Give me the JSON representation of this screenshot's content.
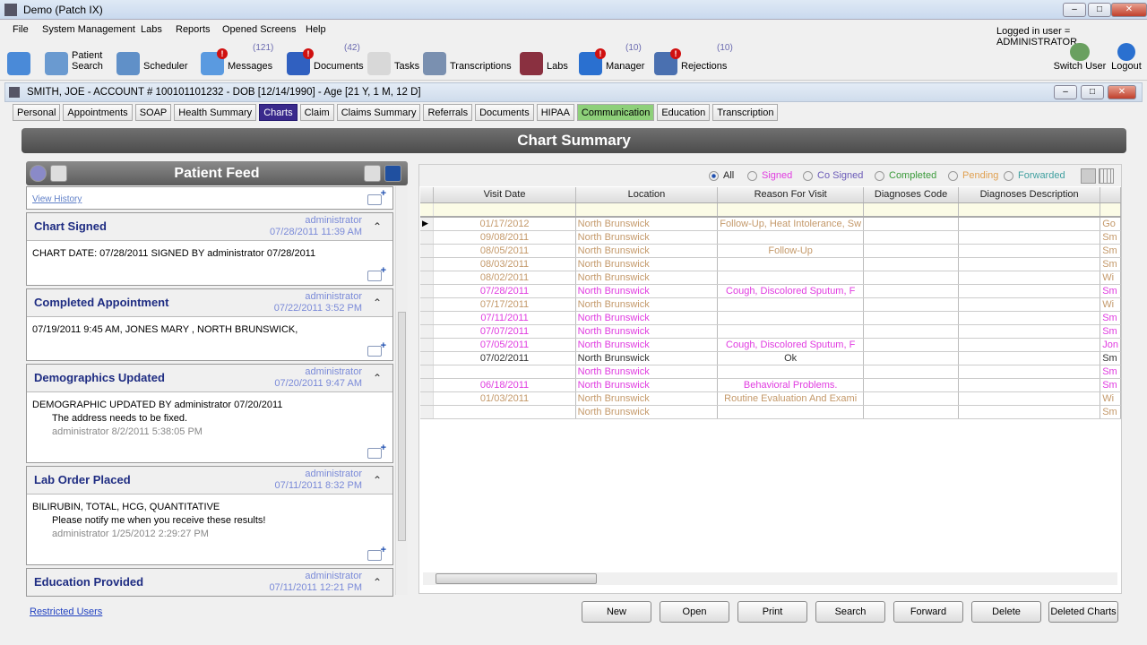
{
  "window": {
    "title": "Demo (Patch IX)"
  },
  "menu": [
    "File",
    "System Management",
    "Labs",
    "Reports",
    "Opened Screens",
    "Help"
  ],
  "logged_in": "Logged in user = ADMINISTRATOR",
  "toolbar": [
    {
      "label": "",
      "icon": "home-icon",
      "color": "#4a8ad8"
    },
    {
      "label": "Patient\nSearch",
      "icon": "patient-search-icon",
      "color": "#6a9ad0"
    },
    {
      "label": "Scheduler",
      "icon": "scheduler-icon",
      "color": "#6090c8"
    },
    {
      "label": "Messages",
      "icon": "messages-icon",
      "color": "#5a9ae0",
      "count": "(121)",
      "alert": true
    },
    {
      "label": "Documents",
      "icon": "documents-icon",
      "color": "#3060c0",
      "count": "(42)",
      "alert": true
    },
    {
      "label": "Tasks",
      "icon": "tasks-icon",
      "color": "#d8d8d8"
    },
    {
      "label": "Transcriptions",
      "icon": "transcriptions-icon",
      "color": "#7a90b0"
    },
    {
      "label": "Labs",
      "icon": "labs-icon",
      "color": "#8a3040"
    },
    {
      "label": "Manager",
      "icon": "rx-manager-icon",
      "color": "#2a70d0",
      "count": "(10)",
      "alert": true
    },
    {
      "label": "Rejections",
      "icon": "rejections-icon",
      "color": "#4a70b0",
      "count": "(10)",
      "alert": true
    }
  ],
  "switch_user": "Switch User",
  "logout": "Logout",
  "patient": {
    "header": "SMITH, JOE - ACCOUNT # 100101101232 - DOB [12/14/1990] - Age [21 Y, 1 M, 12 D]"
  },
  "tabs": [
    {
      "label": "Personal"
    },
    {
      "label": "Appointments"
    },
    {
      "label": "SOAP"
    },
    {
      "label": "Health Summary"
    },
    {
      "label": "Charts",
      "active": true
    },
    {
      "label": "Claim"
    },
    {
      "label": "Claims Summary"
    },
    {
      "label": "Referrals"
    },
    {
      "label": "Documents"
    },
    {
      "label": "HIPAA"
    },
    {
      "label": "Communication",
      "green": true
    },
    {
      "label": "Education"
    },
    {
      "label": "Transcription"
    }
  ],
  "summary_title": "Chart Summary",
  "feed": {
    "title": "Patient Feed",
    "view_history": "View History",
    "cards": [
      {
        "title": "Chart Signed",
        "user": "administrator",
        "time": "07/28/2011 11:39 AM",
        "text": "CHART DATE: 07/28/2011 SIGNED BY administrator 07/28/2011",
        "note": "",
        "meta": ""
      },
      {
        "title": "Completed Appointment",
        "user": "administrator",
        "time": "07/22/2011 3:52 PM",
        "text": "07/19/2011 9:45 AM, JONES MARY  , NORTH BRUNSWICK,",
        "note": "",
        "meta": ""
      },
      {
        "title": "Demographics Updated",
        "user": "administrator",
        "time": "07/20/2011 9:47 AM",
        "text": "DEMOGRAPHIC UPDATED BY administrator 07/20/2011",
        "note": "The address needs to be fixed.",
        "meta": "administrator 8/2/2011 5:38:05 PM"
      },
      {
        "title": "Lab Order Placed",
        "user": "administrator",
        "time": "07/11/2011 8:32 PM",
        "text": "BILIRUBIN, TOTAL, HCG, QUANTITATIVE",
        "note": "Please notify me when you receive these results!",
        "meta": "administrator 1/25/2012 2:29:27 PM"
      },
      {
        "title": "Education Provided",
        "user": "administrator",
        "time": "07/11/2011 12:21 PM",
        "text": "",
        "note": "",
        "meta": ""
      }
    ]
  },
  "filters": [
    {
      "label": "All",
      "color": "#222",
      "checked": true
    },
    {
      "label": "Signed",
      "color": "#e03ce0"
    },
    {
      "label": "Co Signed",
      "color": "#6a5ab8"
    },
    {
      "label": "Completed",
      "color": "#3a9a3a"
    },
    {
      "label": "Pending",
      "color": "#e0a050"
    },
    {
      "label": "Forwarded",
      "color": "#40a0a0"
    }
  ],
  "grid": {
    "columns": [
      "Visit Date",
      "Location",
      "Reason For Visit",
      "Diagnoses Code",
      "Diagnoses Description",
      ""
    ],
    "status_colors": {
      "completed": "#c4996a",
      "signed": "#e03ce0",
      "open": "#333333"
    },
    "rows": [
      [
        "01/17/2012",
        "North Brunswick",
        "Follow-Up, Heat Intolerance, Sw",
        "",
        "",
        "Go",
        "completed"
      ],
      [
        "09/08/2011",
        "North Brunswick",
        "",
        "",
        "",
        "Sm",
        "completed"
      ],
      [
        "08/05/2011",
        "North Brunswick",
        "Follow-Up",
        "",
        "",
        "Sm",
        "completed"
      ],
      [
        "08/03/2011",
        "North Brunswick",
        "",
        "",
        "",
        "Sm",
        "completed"
      ],
      [
        "08/02/2011",
        "North Brunswick",
        "",
        "",
        "",
        "Wi",
        "completed"
      ],
      [
        "07/28/2011",
        "North Brunswick",
        "Cough, Discolored Sputum, F",
        "",
        "",
        "Sm",
        "signed"
      ],
      [
        "07/17/2011",
        "North Brunswick",
        "",
        "",
        "",
        "Wi",
        "completed"
      ],
      [
        "07/11/2011",
        "North Brunswick",
        "",
        "",
        "",
        "Sm",
        "signed"
      ],
      [
        "07/07/2011",
        "North Brunswick",
        "",
        "",
        "",
        "Sm",
        "signed"
      ],
      [
        "07/05/2011",
        "North Brunswick",
        "Cough, Discolored Sputum, F",
        "",
        "",
        "Jon",
        "signed"
      ],
      [
        "07/02/2011",
        "North Brunswick",
        "Ok",
        "",
        "",
        "Sm",
        "open"
      ],
      [
        "",
        "North Brunswick",
        "",
        "",
        "",
        "Sm",
        "signed"
      ],
      [
        "06/18/2011",
        "North Brunswick",
        "Behavioral Problems.",
        "",
        "",
        "Sm",
        "signed"
      ],
      [
        "01/03/2011",
        "North Brunswick",
        "Routine Evaluation And Exami",
        "",
        "",
        "Wi",
        "completed"
      ],
      [
        "",
        "North Brunswick",
        "",
        "",
        "",
        "Sm",
        "completed"
      ]
    ]
  },
  "buttons": [
    "New",
    "Open",
    "Print",
    "Search",
    "Forward",
    "Delete",
    "Deleted Charts"
  ],
  "restricted_users": "Restricted Users"
}
